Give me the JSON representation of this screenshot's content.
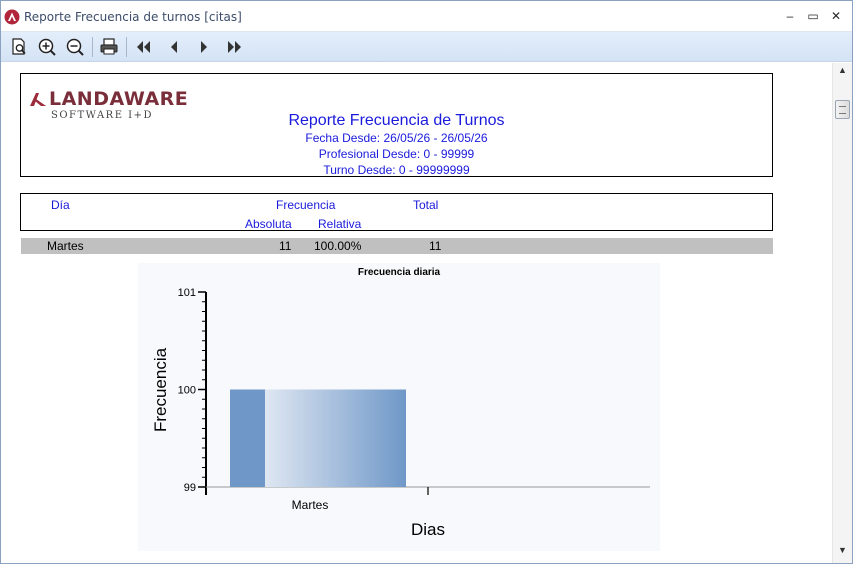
{
  "window": {
    "title": "Reporte Frecuencia de turnos [citas]",
    "minimize_glyph": "‒",
    "maximize_glyph": "▭",
    "close_glyph": "✕"
  },
  "toolbar": {
    "buttons": [
      "preview-icon",
      "zoom-in-icon",
      "zoom-out-icon",
      "print-icon",
      "first-page-icon",
      "prev-page-icon",
      "next-page-icon",
      "last-page-icon"
    ]
  },
  "report": {
    "logo": {
      "name": "LANDAWARE",
      "tagline": "SOFTWARE I+D"
    },
    "title": "Reporte Frecuencia de Turnos",
    "fecha": "Fecha Desde: 26/05/26 - 26/05/26",
    "profesional": "Profesional Desde: 0 - 99999",
    "turno": "Turno Desde: 0 - 99999999",
    "columns": {
      "dia": "Día",
      "frecuencia": "Frecuencia",
      "total": "Total",
      "absoluta": "Absoluta",
      "relativa": "Relativa"
    },
    "rows": [
      {
        "dia": "Martes",
        "absoluta": "11",
        "relativa": "100.00%",
        "total": "11"
      }
    ]
  },
  "chart_data": {
    "type": "bar",
    "title": "Frecuencia diaria",
    "xlabel": "Dias",
    "ylabel": "Frecuencia",
    "categories": [
      "Martes"
    ],
    "values": [
      100
    ],
    "ylim": [
      99,
      101
    ],
    "yticks": [
      "99",
      "100",
      "101"
    ],
    "grid": false,
    "colors": {
      "bar_dark": "#6f98c8",
      "bar_light": "#dfe7f2",
      "background": "#f8f9fc"
    }
  },
  "scrollbar": {
    "up_glyph": "▲",
    "down_glyph": "▼"
  }
}
